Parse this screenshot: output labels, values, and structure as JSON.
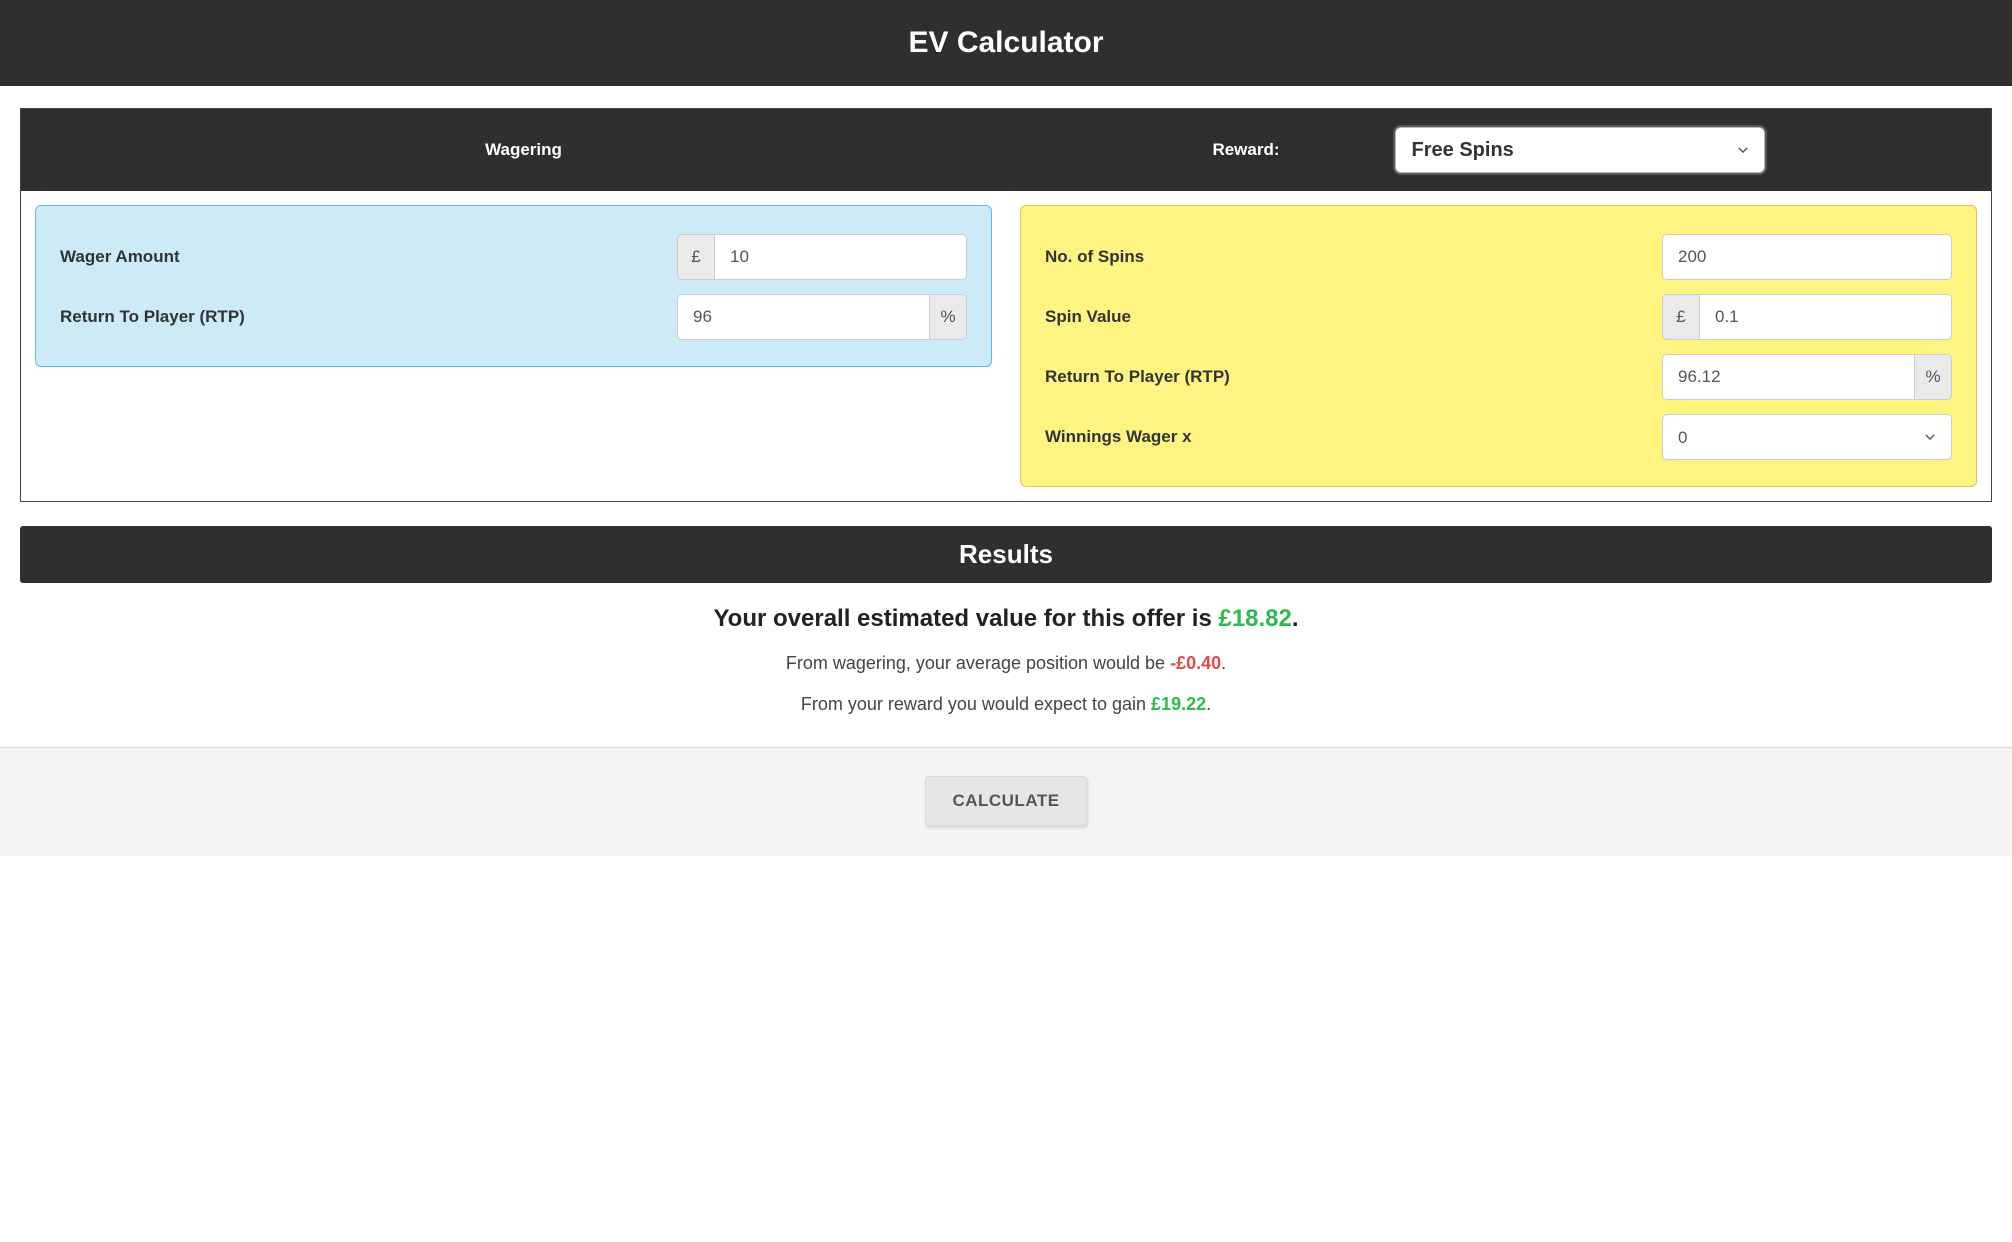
{
  "header": {
    "title": "EV Calculator"
  },
  "panel": {
    "wagering_label": "Wagering",
    "reward_label": "Reward:",
    "reward_selected": "Free Spins"
  },
  "wagering": {
    "wager_amount_label": "Wager Amount",
    "wager_amount_value": "10",
    "currency_prefix": "£",
    "rtp_label": "Return To Player (RTP)",
    "rtp_value": "96",
    "percent_suffix": "%"
  },
  "reward": {
    "spins_label": "No. of Spins",
    "spins_value": "200",
    "spin_value_label": "Spin Value",
    "spin_value_value": "0.1",
    "currency_prefix": "£",
    "rtp_label": "Return To Player (RTP)",
    "rtp_value": "96.12",
    "percent_suffix": "%",
    "winnings_wager_label": "Winnings Wager x",
    "winnings_wager_value": "0"
  },
  "results": {
    "title": "Results",
    "headline_prefix": "Your overall estimated value for this offer is ",
    "headline_value": "£18.82",
    "headline_suffix": ".",
    "wager_line_prefix": "From wagering, your average position would be ",
    "wager_line_value": "-£0.40",
    "wager_line_suffix": ".",
    "reward_line_prefix": "From your reward you would expect to gain ",
    "reward_line_value": "£19.22",
    "reward_line_suffix": "."
  },
  "footer": {
    "calculate_label": "CALCULATE"
  }
}
